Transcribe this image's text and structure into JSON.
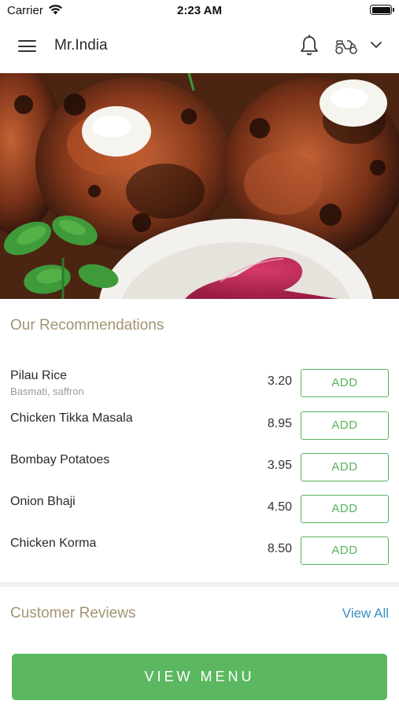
{
  "status_bar": {
    "carrier": "Carrier",
    "time": "2:23 AM"
  },
  "header": {
    "title": "Mr.India"
  },
  "recommendations": {
    "title": "Our Recommendations",
    "items": [
      {
        "name": "Pilau Rice",
        "description": "Basmati, saffron",
        "price": "3.20",
        "action": "ADD"
      },
      {
        "name": "Chicken Tikka Masala",
        "description": "",
        "price": "8.95",
        "action": "ADD"
      },
      {
        "name": "Bombay Potatoes",
        "description": "",
        "price": "3.95",
        "action": "ADD"
      },
      {
        "name": "Onion Bhaji",
        "description": "",
        "price": "4.50",
        "action": "ADD"
      },
      {
        "name": "Chicken Korma",
        "description": "",
        "price": "8.50",
        "action": "ADD"
      }
    ]
  },
  "reviews": {
    "title": "Customer Reviews",
    "view_all": "View All"
  },
  "footer": {
    "view_menu": "VIEW MENU"
  },
  "colors": {
    "accent_green": "#5bb861",
    "section_title": "#a39373",
    "link_blue": "#3a8fc4"
  },
  "icons": [
    "wifi-icon",
    "battery-icon",
    "menu-icon",
    "bell-icon",
    "scooter-icon",
    "chevron-down-icon"
  ]
}
